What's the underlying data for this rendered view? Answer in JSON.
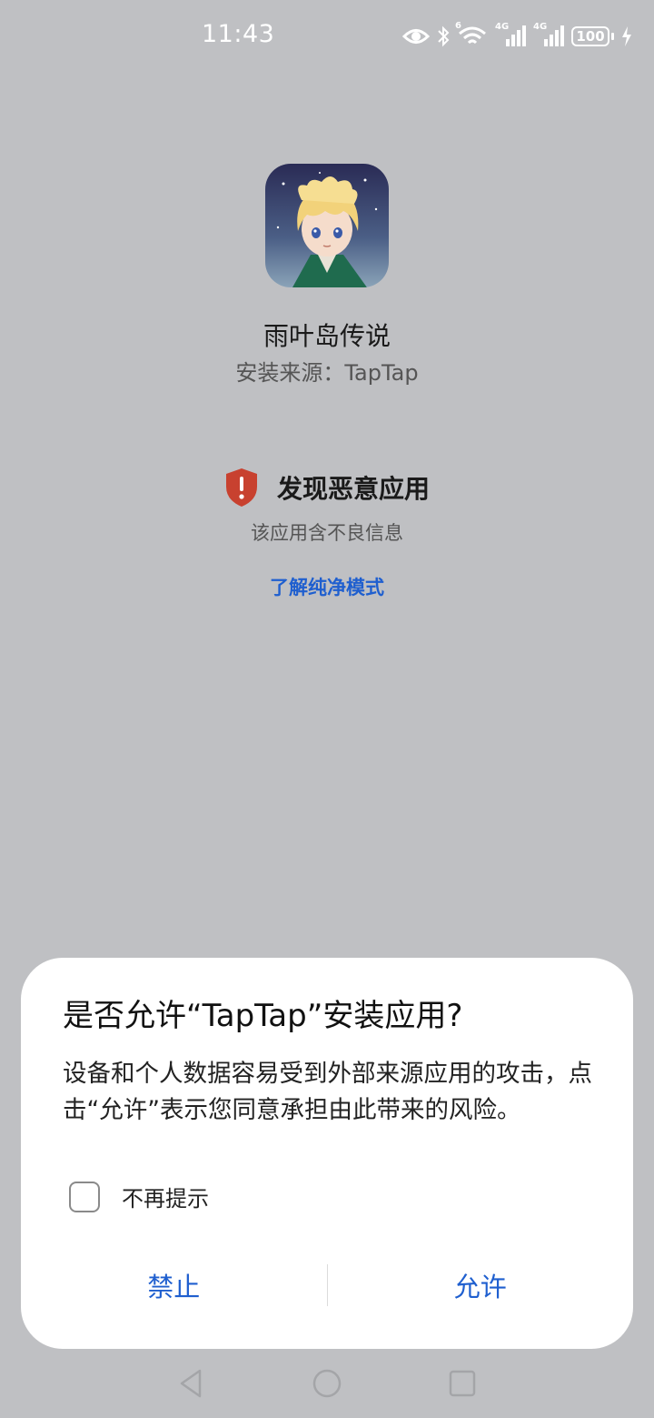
{
  "status_bar": {
    "time": "11:43",
    "icons": [
      "eye-icon",
      "bluetooth-icon",
      "wifi-icon",
      "signal-4g-icon",
      "signal-4g-icon",
      "battery-icon",
      "charging-icon"
    ],
    "wifi_tag": "6",
    "network_label_1": "4G",
    "network_label_2": "4G",
    "battery_level": "100"
  },
  "app": {
    "name": "雨叶岛传说",
    "source": "安装来源：TapTap",
    "icon": "app-icon-anime-character"
  },
  "warning": {
    "title": "发现恶意应用",
    "description": "该应用含不良信息",
    "link": "了解纯净模式",
    "icon": "shield-alert-icon",
    "color": "#c8412f"
  },
  "dialog": {
    "title": "是否允许“TapTap”安装应用?",
    "body": "设备和个人数据容易受到外部来源应用的攻击，点击“允许”表示您同意承担由此带来的风险。",
    "checkbox_label": "不再提示",
    "checkbox_checked": false,
    "deny_button": "禁止",
    "allow_button": "允许",
    "accent_color": "#1f5fcf"
  },
  "nav_bar": {
    "icons": [
      "back-icon",
      "home-icon",
      "recents-icon"
    ]
  }
}
